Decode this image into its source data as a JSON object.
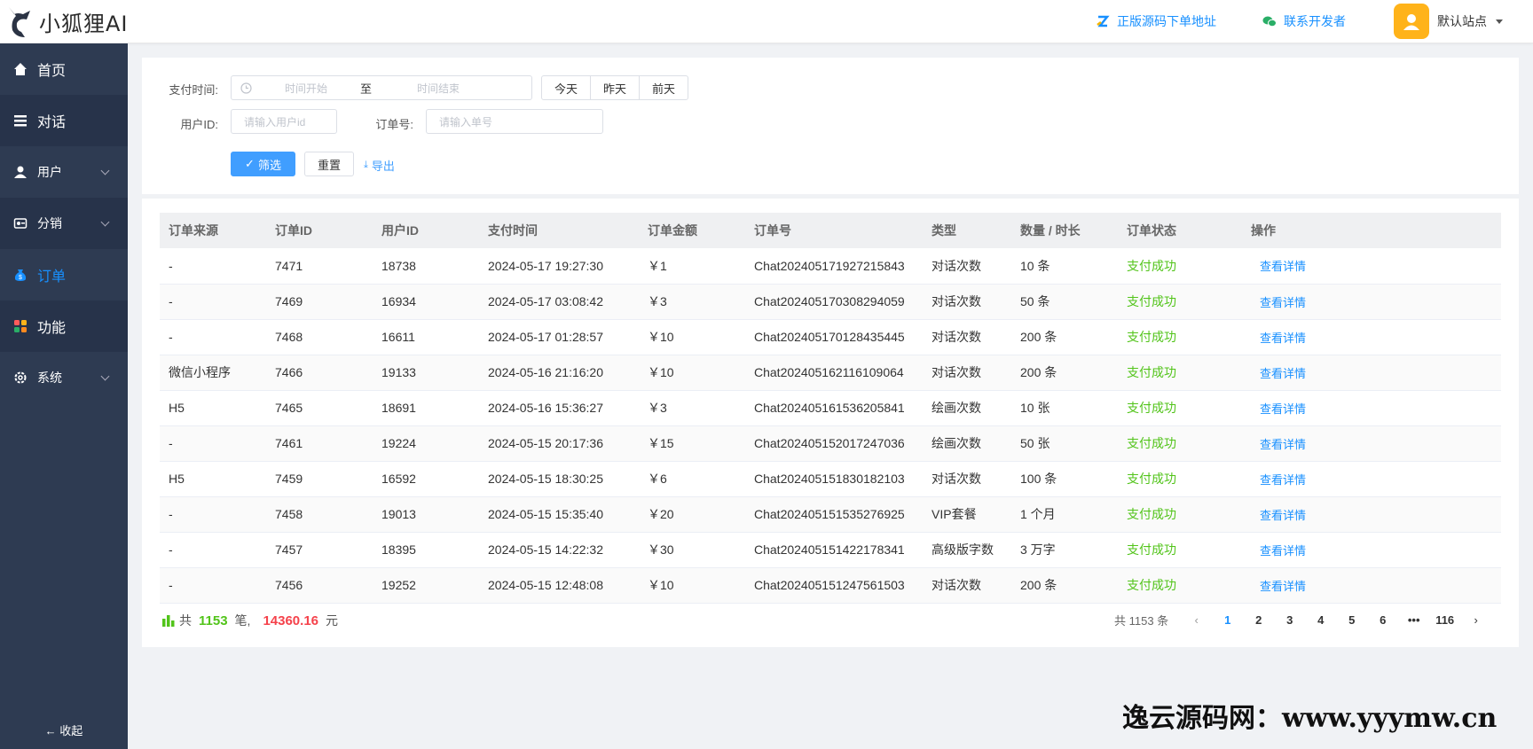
{
  "header": {
    "logo_text": "小狐狸AI",
    "link_source": "正版源码下单地址",
    "link_contact": "联系开发者",
    "user_name": "默认站点"
  },
  "sidebar": {
    "items": [
      {
        "label": "首页",
        "icon": "home-icon"
      },
      {
        "label": "对话",
        "icon": "list-icon"
      },
      {
        "label": "用户",
        "icon": "user-icon"
      },
      {
        "label": "分销",
        "icon": "distribution-icon"
      },
      {
        "label": "订单",
        "icon": "money-bag-icon"
      },
      {
        "label": "功能",
        "icon": "apps-icon"
      },
      {
        "label": "系统",
        "icon": "settings-icon"
      }
    ],
    "collapse_label": "收起"
  },
  "filter": {
    "pay_time_label": "支付时间:",
    "start_placeholder": "时间开始",
    "range_separator": "至",
    "end_placeholder": "时间结束",
    "today": "今天",
    "yesterday": "昨天",
    "day_before": "前天",
    "user_id_label": "用户ID:",
    "user_id_placeholder": "请输入用户id",
    "order_no_label": "订单号:",
    "order_no_placeholder": "请输入单号",
    "filter_btn": "筛选",
    "reset_btn": "重置",
    "export_btn": "导出"
  },
  "table": {
    "columns": [
      "订单来源",
      "订单ID",
      "用户ID",
      "支付时间",
      "订单金额",
      "订单号",
      "类型",
      "数量 / 时长",
      "订单状态",
      "操作"
    ],
    "rows": [
      [
        "-",
        "7471",
        "18738",
        "2024-05-17 19:27:30",
        "￥1",
        "Chat202405171927215843",
        "对话次数",
        "10 条",
        "支付成功",
        "查看详情"
      ],
      [
        "-",
        "7469",
        "16934",
        "2024-05-17 03:08:42",
        "￥3",
        "Chat202405170308294059",
        "对话次数",
        "50 条",
        "支付成功",
        "查看详情"
      ],
      [
        "-",
        "7468",
        "16611",
        "2024-05-17 01:28:57",
        "￥10",
        "Chat202405170128435445",
        "对话次数",
        "200 条",
        "支付成功",
        "查看详情"
      ],
      [
        "微信小程序",
        "7466",
        "19133",
        "2024-05-16 21:16:20",
        "￥10",
        "Chat202405162116109064",
        "对话次数",
        "200 条",
        "支付成功",
        "查看详情"
      ],
      [
        "H5",
        "7465",
        "18691",
        "2024-05-16 15:36:27",
        "￥3",
        "Chat202405161536205841",
        "绘画次数",
        "10 张",
        "支付成功",
        "查看详情"
      ],
      [
        "-",
        "7461",
        "19224",
        "2024-05-15 20:17:36",
        "￥15",
        "Chat202405152017247036",
        "绘画次数",
        "50 张",
        "支付成功",
        "查看详情"
      ],
      [
        "H5",
        "7459",
        "16592",
        "2024-05-15 18:30:25",
        "￥6",
        "Chat202405151830182103",
        "对话次数",
        "100 条",
        "支付成功",
        "查看详情"
      ],
      [
        "-",
        "7458",
        "19013",
        "2024-05-15 15:35:40",
        "￥20",
        "Chat202405151535276925",
        "VIP套餐",
        "1 个月",
        "支付成功",
        "查看详情"
      ],
      [
        "-",
        "7457",
        "18395",
        "2024-05-15 14:22:32",
        "￥30",
        "Chat202405151422178341",
        "高级版字数",
        "3 万字",
        "支付成功",
        "查看详情"
      ],
      [
        "-",
        "7456",
        "19252",
        "2024-05-15 12:48:08",
        "￥10",
        "Chat202405151247561503",
        "对话次数",
        "200 条",
        "支付成功",
        "查看详情"
      ]
    ]
  },
  "summary": {
    "prefix": "共",
    "count": "1153",
    "count_unit": "笔,",
    "amount": "14360.16",
    "amount_unit": "元"
  },
  "pager": {
    "total": "共 1153 条",
    "pages": [
      "1",
      "2",
      "3",
      "4",
      "5",
      "6",
      "•••",
      "116"
    ],
    "active": "1"
  },
  "watermark": "逸云源码网：www.yyymw.cn"
}
